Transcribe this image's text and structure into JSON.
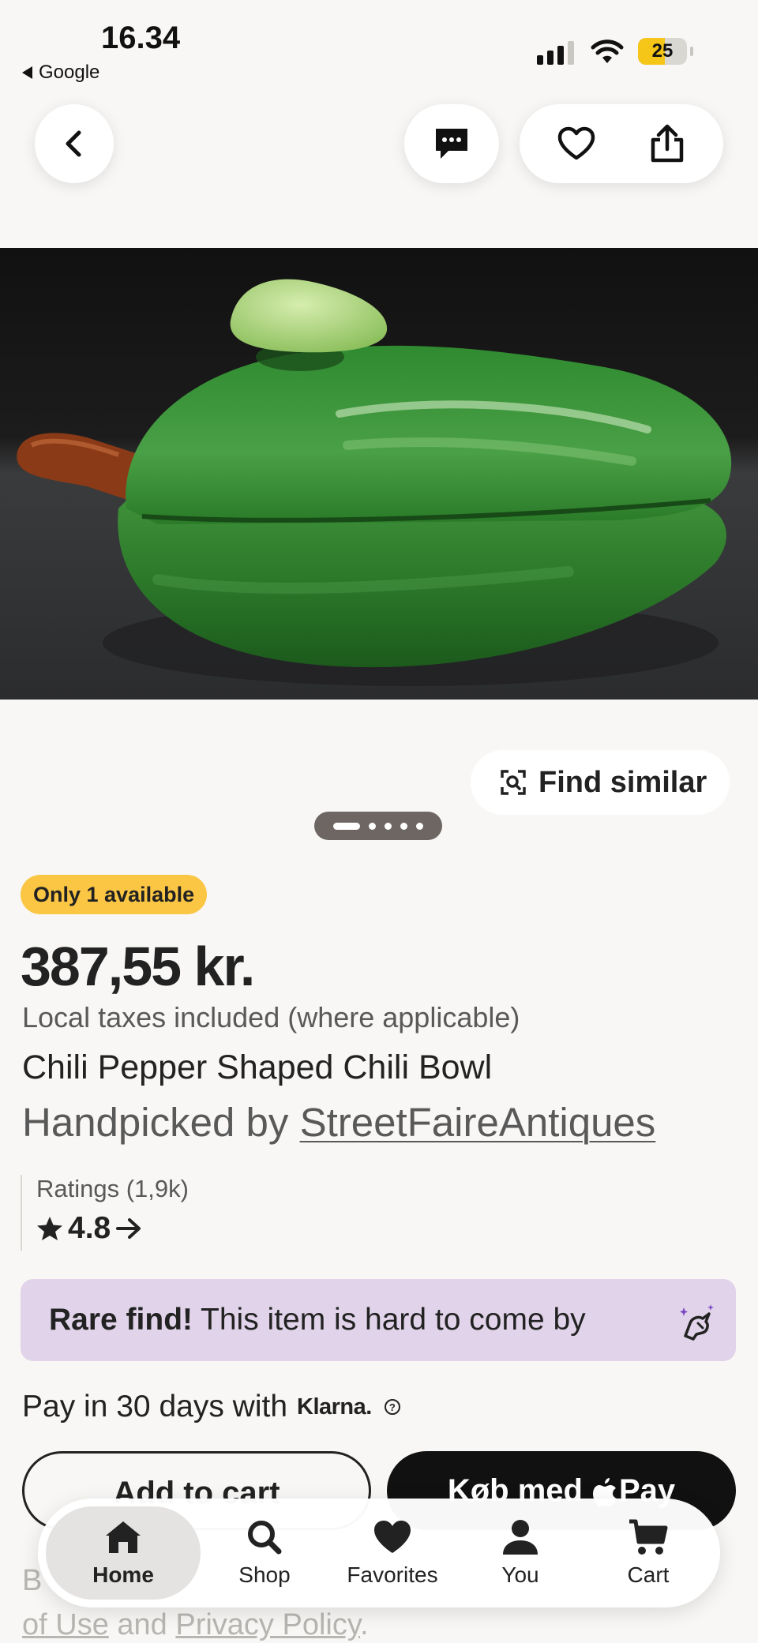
{
  "status_bar": {
    "time": "16.34",
    "back_app": "Google",
    "battery": "25"
  },
  "top_bar": {
    "back_icon": "chevron-left-icon",
    "message_icon": "chat-bubble-icon",
    "favorite_icon": "heart-outline-icon",
    "share_icon": "share-icon"
  },
  "gallery": {
    "image_alt": "Chili Pepper Shaped Chili Bowl",
    "find_similar_label": "Find similar",
    "dot_count": 5,
    "active_dot": 0
  },
  "listing": {
    "stock_badge": "Only 1 available",
    "price": "387,55 kr.",
    "tax_note": "Local taxes included (where applicable)",
    "title": "Chili Pepper Shaped Chili Bowl",
    "handpicked_prefix": "Handpicked by",
    "shop_name": "StreetFaireAntiques",
    "ratings_label": "Ratings (1,9k)",
    "rating_value": "4.8",
    "rare_bold": "Rare find!",
    "rare_text": "This item is hard to come by",
    "klarna_prefix": "Pay in 30 days with",
    "klarna_logo": "Klarna.",
    "info_glyph": "?",
    "add_to_cart": "Add to cart",
    "apple_pay_prefix": "Køb med",
    "apple_pay_suffix": "Pay",
    "terms_line1_start": "B",
    "terms_link1": "of Use",
    "terms_and": "and",
    "terms_link2": "Privacy Policy",
    "terms_end": "."
  },
  "tab_bar": {
    "tabs": [
      {
        "label": "Home",
        "icon": "home-icon",
        "active": true
      },
      {
        "label": "Shop",
        "icon": "search-icon",
        "active": false
      },
      {
        "label": "Favorites",
        "icon": "heart-icon",
        "active": false
      },
      {
        "label": "You",
        "icon": "person-icon",
        "active": false
      },
      {
        "label": "Cart",
        "icon": "cart-icon",
        "active": false
      }
    ]
  },
  "colors": {
    "background": "#f8f7f5",
    "badge": "#fbc644",
    "rare_banner": "#e1d4ea",
    "text_primary": "#222222",
    "text_secondary": "#595959"
  }
}
